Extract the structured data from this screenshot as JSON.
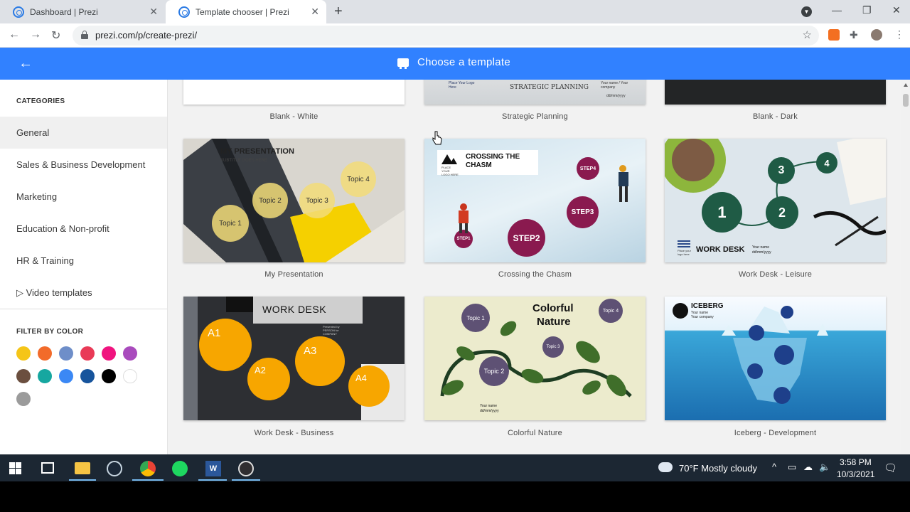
{
  "browser": {
    "tabs": [
      {
        "title": "Dashboard | Prezi",
        "active": false
      },
      {
        "title": "Template chooser | Prezi",
        "active": true
      }
    ],
    "url": "prezi.com/p/create-prezi/",
    "new_tab_glyph": "+",
    "close_glyph": "✕"
  },
  "header": {
    "title": "Choose a template",
    "back_glyph": "←",
    "icon": "presentation-icon",
    "color": "#3181ff"
  },
  "sidebar": {
    "categories_heading": "CATEGORIES",
    "categories": [
      {
        "label": "General",
        "active": true
      },
      {
        "label": "Sales & Business Development"
      },
      {
        "label": "Marketing"
      },
      {
        "label": "Education & Non-profit"
      },
      {
        "label": "HR & Training"
      },
      {
        "label": "▷ Video templates"
      }
    ],
    "filter_heading": "FILTER BY COLOR",
    "colors": [
      "#f5c518",
      "#f26b2a",
      "#6e8ec9",
      "#e93a57",
      "#f0147f",
      "#a94bbd",
      "#6b4f3f",
      "#16a7a0",
      "#3b88f5",
      "#17549c",
      "#000000",
      "#ffffff",
      "#9b9b9b"
    ]
  },
  "templates": {
    "row0": [
      "Blank - White",
      "Strategic Planning",
      "Blank - Dark"
    ],
    "row1": [
      "My Presentation",
      "Crossing the Chasm",
      "Work Desk - Leisure"
    ],
    "row2": [
      "Work Desk - Business",
      "Colorful Nature",
      "Iceberg - Development"
    ]
  },
  "thumbs": {
    "strategic": {
      "logo": "Place Your Logo Here",
      "title": "STRATEGIC PLANNING",
      "name": "Your name / Your company",
      "date": "dd/mm/yyyy"
    },
    "mypres": {
      "title": "MY PRESENTATION",
      "subtitle": "SUBTITLE GOES HERE",
      "topics": [
        "Topic 1",
        "Topic 2",
        "Topic 3",
        "Topic 4"
      ]
    },
    "chasm": {
      "title": "CROSSING THE CHASM",
      "logo": "PLACE YOUR LOGO HERE",
      "steps": [
        "STEP1",
        "STEP2",
        "STEP3",
        "STEP4"
      ]
    },
    "leisure": {
      "nums": [
        "1",
        "2",
        "3",
        "4"
      ],
      "title": "WORK DESK",
      "name": "Your name",
      "date": "dd/mm/yyyy",
      "logo": "Place your logo here"
    },
    "business": {
      "title": "WORK DESK",
      "presented": "Presented by PERSON for COMPANY",
      "items": [
        "A1",
        "A2",
        "A3",
        "A4"
      ]
    },
    "nature": {
      "title_line1": "Colorful",
      "title_line2": "Nature",
      "topics": [
        "Topic 1",
        "Topic 2",
        "Topic 3",
        "Topic 4"
      ],
      "name": "Your name",
      "date": "dd/mm/yyyy"
    },
    "iceberg": {
      "title": "ICEBERG",
      "name": "Your name",
      "company": "Your company"
    }
  },
  "taskbar": {
    "weather": "70°F  Mostly cloudy",
    "time": "3:58 PM",
    "date": "10/3/2021"
  }
}
